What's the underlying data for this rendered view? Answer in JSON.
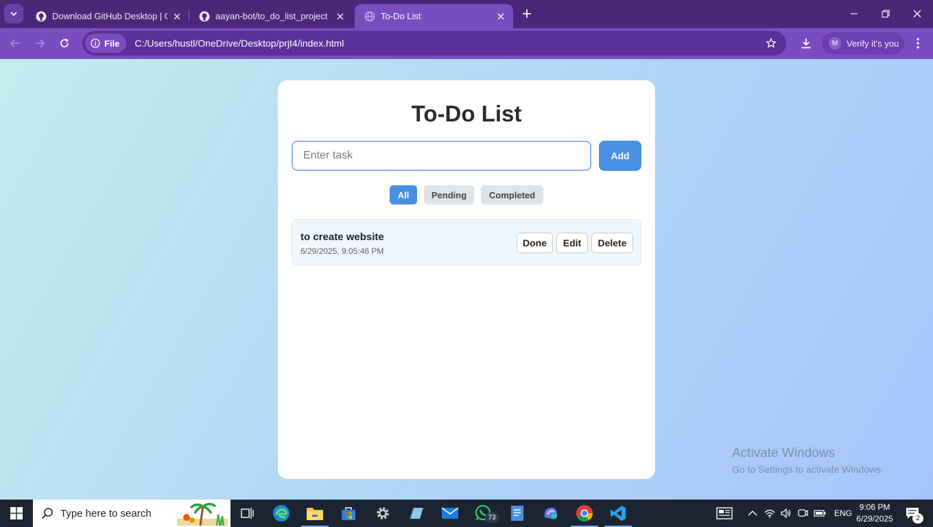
{
  "browser": {
    "tabs": [
      {
        "title": "Download GitHub Desktop | GitHub Docs"
      },
      {
        "title": "aayan-bot/to_do_list_project"
      },
      {
        "title": "To-Do List"
      }
    ],
    "scheme_chip": "File",
    "url": "C:/Users/hustl/OneDrive/Desktop/prjt4/index.html",
    "profile_initial": "M",
    "profile_label": "Verify it's you"
  },
  "app": {
    "title": "To-Do List",
    "input_placeholder": "Enter task",
    "input_value": "",
    "add_label": "Add",
    "filters": [
      {
        "label": "All",
        "active": true
      },
      {
        "label": "Pending",
        "active": false
      },
      {
        "label": "Completed",
        "active": false
      }
    ],
    "tasks": [
      {
        "text": "to create website",
        "timestamp": "6/29/2025, 9:05:46 PM",
        "actions": [
          "Done",
          "Edit",
          "Delete"
        ]
      }
    ],
    "colors": {
      "accent": "#4a90e2",
      "task_bg": "#f0f6fd"
    }
  },
  "watermark": {
    "line1": "Activate Windows",
    "line2": "Go to Settings to activate Windows."
  },
  "taskbar": {
    "search_placeholder": "Type here to search",
    "whatsapp_badge": "73",
    "lang": "ENG",
    "time": "9:06 PM",
    "date": "6/29/2025",
    "notification_count": "2"
  }
}
